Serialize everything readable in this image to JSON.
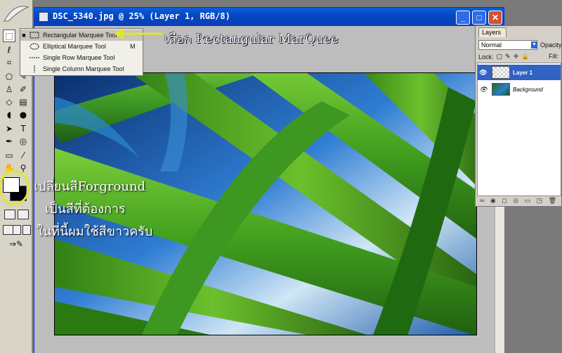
{
  "document": {
    "title": "DSC_5340.jpg @ 25% (Layer 1, RGB/8)",
    "buttons": {
      "minimize": "_",
      "maximize": "□",
      "close": "✕"
    }
  },
  "flyout": {
    "items": [
      {
        "label": "Rectangular Marquee Tool",
        "shortcut": "",
        "selected": true
      },
      {
        "label": "Elliptical Marquee Tool",
        "shortcut": "M",
        "selected": false
      },
      {
        "label": "Single Row Marquee Tool",
        "shortcut": "",
        "selected": false
      },
      {
        "label": "Single Column Marquee Tool",
        "shortcut": "",
        "selected": false
      }
    ]
  },
  "annotations": {
    "select_tool": "เลือก Rectangular MarQuee",
    "line1": "เปลี่ยนสีForground",
    "line2": "เป็นสีที่ต้องการ",
    "line3": "ในที่นี้ผมใช้สีขาวครับ"
  },
  "layers": {
    "tab": "Layers",
    "blend_mode": "Normal",
    "opacity_label": "Opacity:",
    "lock_label": "Lock:",
    "fill_label": "Fill:",
    "items": [
      {
        "name": "Layer 1",
        "active": true
      },
      {
        "name": "Background",
        "active": false
      }
    ],
    "footer_icons": "∞ ◉ ◻ ◎ ▭ ◳ 🗑"
  },
  "colors": {
    "accent_title": "#0446c4",
    "layer_selected": "#3163c5",
    "annotation_ring": "#dfe82a"
  }
}
